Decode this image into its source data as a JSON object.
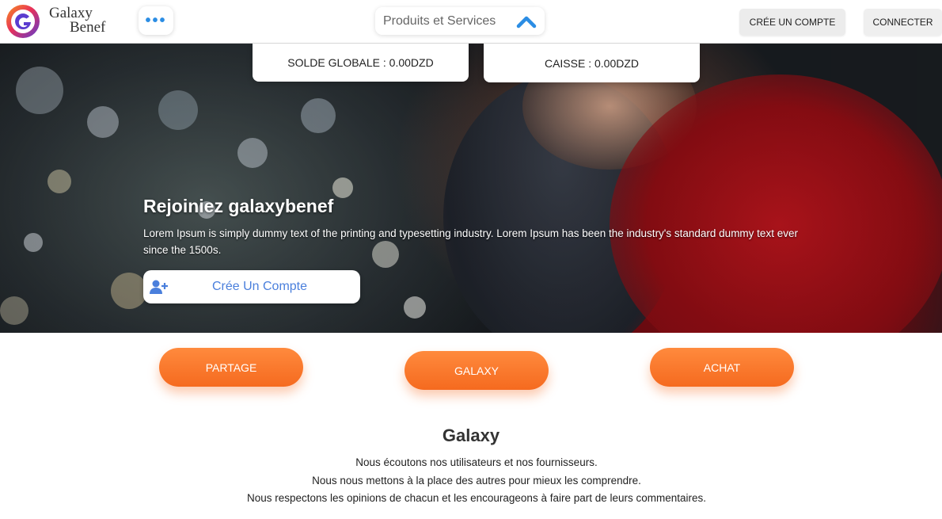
{
  "header": {
    "logo_line1": "Galaxy",
    "logo_line2": "Benef",
    "more_label": "•••",
    "products_label": "Produits et Services",
    "create_account_label": "CRÉE UN COMPTE",
    "login_label": "CONNECTER"
  },
  "summary": {
    "solde_label": "SOLDE GLOBALE : 0.00DZD",
    "caisse_label": "CAISSE : 0.00DZD"
  },
  "hero": {
    "title": "Rejoiniez galaxybenef",
    "text": "Lorem Ipsum is simply dummy text of the printing and typesetting industry. Lorem Ipsum has been the industry's standard dummy text ever since the 1500s.",
    "cta_label": "Crée Un Compte"
  },
  "actions": {
    "partage": "PARTAGE",
    "galaxy": "GALAXY",
    "achat": "ACHAT"
  },
  "about": {
    "title": "Galaxy",
    "lines": [
      "Nous écoutons nos utilisateurs et nos fournisseurs.",
      "Nous nous mettons à la place des autres pour mieux les comprendre.",
      "Nous respectons les opinions de chacun et les encourageons à faire part de leurs commentaires."
    ]
  },
  "colors": {
    "accent_orange": "#f56a1f",
    "link_blue": "#4a7fdc",
    "icon_blue": "#2b8de4"
  },
  "icons": {
    "logo": "galaxy-g-logo-icon",
    "more": "more-dots-icon",
    "products_chevron": "chevron-up-icon",
    "cta": "add-user-icon"
  }
}
